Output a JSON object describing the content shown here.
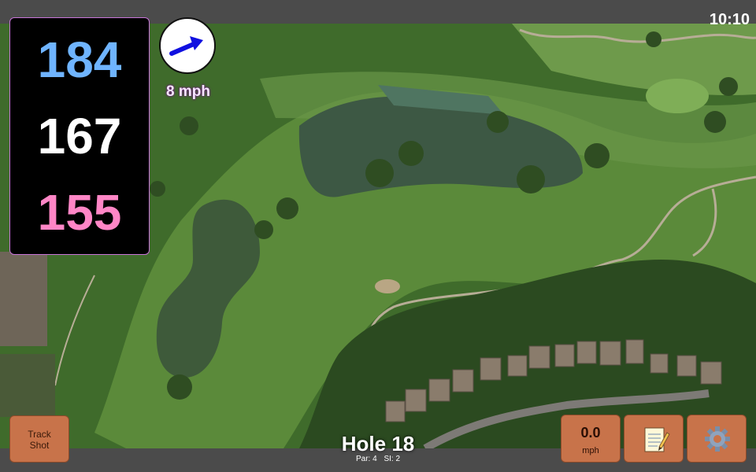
{
  "status": {
    "time": "10:10"
  },
  "yardage": {
    "back": "184",
    "middle": "167",
    "front": "155"
  },
  "wind": {
    "speed": "8 mph",
    "direction_icon": "arrow-right-up-icon"
  },
  "hole": {
    "title": "Hole 18",
    "par": "Par: 4",
    "stroke_index": "SI: 2"
  },
  "buttons": {
    "track_shot_line1": "Track",
    "track_shot_line2": "Shot",
    "speed_value": "0.0",
    "speed_unit": "mph",
    "notes_icon": "notepad-icon",
    "settings_icon": "gear-icon"
  },
  "colors": {
    "back_yardage": "#6fb4ff",
    "middle_yardage": "#ffffff",
    "front_yardage": "#ff86c6",
    "button_fill": "#c8734a"
  }
}
